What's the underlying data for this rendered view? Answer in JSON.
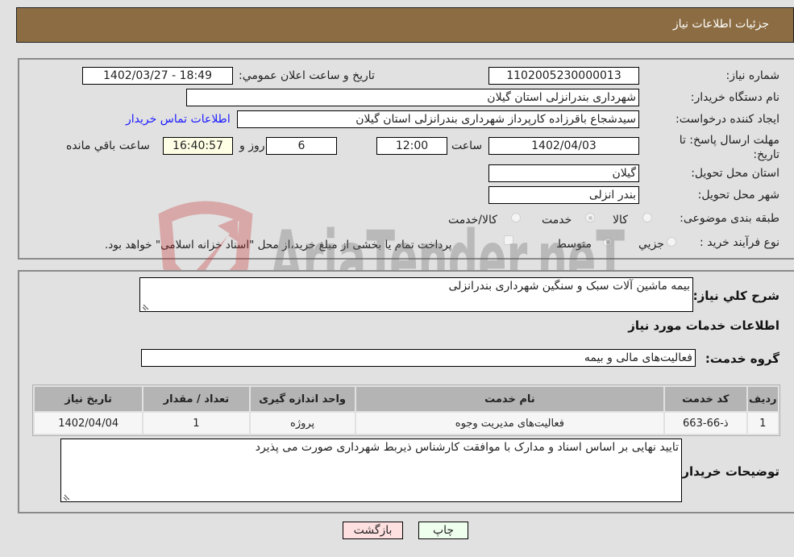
{
  "header": {
    "title": "جزئیات اطلاعات نیاز"
  },
  "form": {
    "need_number": {
      "label": "شماره نیاز:",
      "value": "1102005230000013"
    },
    "announce_datetime": {
      "label": "تاریخ و ساعت اعلان عمومي:",
      "value": "1402/03/27 - 18:49"
    },
    "buyer_org": {
      "label": "نام دستگاه خریدار:",
      "value": "شهرداری بندرانزلی استان گیلان"
    },
    "requester": {
      "label": "ایجاد کننده درخواست:",
      "value": "سیدشجاع باقرزاده کارپرداز شهرداری بندرانزلی استان گیلان"
    },
    "buyer_contact_link": "اطلاعات تماس خریدار",
    "deadline": {
      "label": "مهلت ارسال پاسخ: تا تاریخ:",
      "date": "1402/04/03",
      "time_label": "ساعت",
      "time": "12:00",
      "days": "6",
      "days_label": "روز و",
      "remaining": "16:40:57",
      "remaining_label": "ساعت باقي مانده"
    },
    "province": {
      "label": "استان محل تحویل:",
      "value": "گیلان"
    },
    "city": {
      "label": "شهر محل تحویل:",
      "value": "بندر انزلی"
    },
    "category": {
      "label": "طبقه بندی موضوعی:",
      "options": [
        "کالا",
        "خدمت",
        "کالا/خدمت"
      ],
      "selected": "خدمت"
    },
    "purchase_process": {
      "label": "نوع فرآیند خرید :",
      "options": [
        "جزيي",
        "متوسط"
      ],
      "selected": "متوسط",
      "treasury_checkbox_label": "پرداخت تمام یا بخشی از مبلغ خرید،از محل \"اسناد خزانه اسلامی\" خواهد بود.",
      "treasury_checked": false
    }
  },
  "details": {
    "description_label": "شرح کلي نیاز:",
    "description_value": "بیمه ماشین آلات سبک و سنگین شهرداری بندرانزلی",
    "services_heading": "اطلاعات خدمات مورد نیاز",
    "service_group_label": "گروه خدمت:",
    "service_group_value": "فعالیت‌های مالی و بیمه",
    "table": {
      "headers": [
        "ردیف",
        "کد خدمت",
        "نام خدمت",
        "واحد اندازه گیری",
        "تعداد / مقدار",
        "تاریخ نیاز"
      ],
      "rows": [
        [
          "1",
          "ذ-66-663",
          "فعالیت‌های مدیریت وجوه",
          "پروژه",
          "1",
          "1402/04/04"
        ]
      ]
    },
    "buyer_notes_label": "توضیحات خریدار:",
    "buyer_notes_value": "تایید نهایی بر اساس اسناد و مدارک با  موافقت کارشناس ذیربط شهرداری صورت می پذیرد"
  },
  "buttons": {
    "print": "چاپ",
    "back": "بازگشت"
  },
  "watermark": {
    "text": "AriaTender.neT"
  },
  "colors": {
    "header_bg": "#8c6d43",
    "link": "#1a1aff",
    "back_btn": "#ffe0e0",
    "print_btn": "#efffee"
  }
}
